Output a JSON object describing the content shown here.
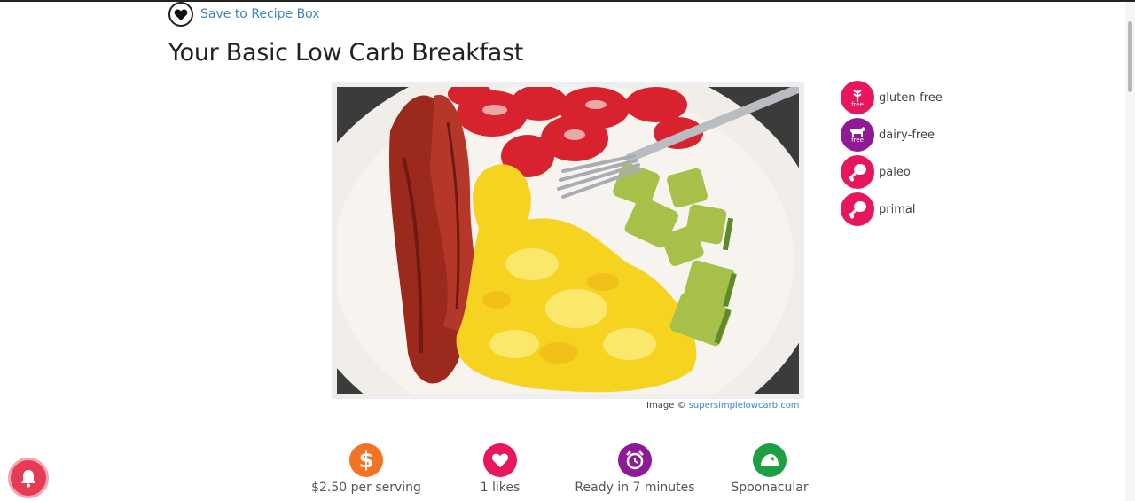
{
  "save": {
    "label": "Save to Recipe Box"
  },
  "recipe": {
    "title": "Your Basic Low Carb Breakfast"
  },
  "image": {
    "credit_prefix": "Image ©",
    "credit_link": "supersimplelowcarb.com"
  },
  "diets": [
    {
      "label": "gluten-free",
      "icon": "wheat-free-icon",
      "badge": "free",
      "color": "#e8175d"
    },
    {
      "label": "dairy-free",
      "icon": "cow-free-icon",
      "badge": "free",
      "color": "#8e1a95"
    },
    {
      "label": "paleo",
      "icon": "drumstick-icon",
      "color": "#e8175d"
    },
    {
      "label": "primal",
      "icon": "drumstick-icon",
      "color": "#e8175d"
    }
  ],
  "stats": [
    {
      "label": "$2.50 per serving",
      "icon": "dollar-icon",
      "color": "#f47321"
    },
    {
      "label": "1 likes",
      "icon": "heart-icon",
      "color": "#e8175d"
    },
    {
      "label": "Ready in 7 minutes",
      "icon": "alarm-clock-icon",
      "color": "#8e1a95"
    },
    {
      "label": "Spoonacular",
      "icon": "spoonacular-icon",
      "color": "#1f9f44"
    }
  ],
  "colors": {
    "link": "#3a87c8",
    "notification": "#e53b55"
  }
}
